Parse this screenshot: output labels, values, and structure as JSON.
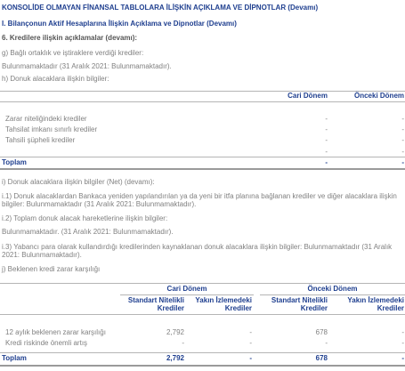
{
  "header": {
    "title": "KONSOLİDE OLMAYAN FİNANSAL TABLOLARA İLİŞKİN AÇIKLAMA VE DİPNOTLAR (Devamı)",
    "section": "I. Bilançonun Aktif Hesaplarına İlişkin Açıklama ve Dipnotlar (Devamı)",
    "subsection": "6. Kredilere ilişkin açıklamalar (devamı):"
  },
  "g": {
    "heading": "g) Bağlı ortaklık ve iştiraklere verdiği krediler:",
    "text": "Bulunmamaktadır (31 Aralık 2021: Bulunmamaktadır)."
  },
  "h": {
    "heading": "h) Donuk alacaklara ilişkin bilgiler:",
    "columns": [
      "Cari Dönem",
      "Önceki Dönem"
    ],
    "rows": [
      {
        "label": "Zarar niteliğindeki krediler",
        "cari": "-",
        "onceki": "-"
      },
      {
        "label": "Tahsilat imkanı sınırlı krediler",
        "cari": "-",
        "onceki": "-"
      },
      {
        "label": "Tahsili şüpheli krediler",
        "cari": "-",
        "onceki": "-"
      },
      {
        "label": "",
        "cari": "-",
        "onceki": "-"
      }
    ],
    "total": {
      "label": "Toplam",
      "cari": "-",
      "onceki": "-"
    }
  },
  "i": {
    "heading": "i) Donuk alacaklara ilişkin bilgiler (Net) (devamı):",
    "i1_line1": "i.1) Donuk alacaklardan Bankaca yeniden yapılandırılan ya da yeni bir itfa planına bağlanan krediler ve diğer alacaklara ilişkin",
    "i1_line2": "bilgiler: Bulunmamaktadır (31 Aralık 2021: Bulunmamaktadır).",
    "i2": "i.2) Toplam donuk alacak hareketlerine ilişkin bilgiler:",
    "i2_text": "Bulunmamaktadır. (31 Aralık 2021: Bulunmamaktadır).",
    "i3_line1": "i.3) Yabancı para olarak kullandırdığı kredilerinden kaynaklanan donuk alacaklara ilişkin bilgiler: Bulunmamaktadır (31 Aralık",
    "i3_line2": "2021: Bulunmamaktadır)."
  },
  "j": {
    "heading": "j) Beklenen kredi zarar karşılığı",
    "groups": [
      "Cari Dönem",
      "Önceki Dönem"
    ],
    "sub1": [
      "Standart Nitelikli",
      "Yakın İzlemedeki",
      "Standart Nitelikli",
      "Yakın İzlemedeki"
    ],
    "sub2": [
      "Krediler",
      "Krediler",
      "Krediler",
      "Krediler"
    ],
    "rows": [
      {
        "label": "12 aylık beklenen zarar karşılığı",
        "v": [
          "2,792",
          "-",
          "678",
          "-"
        ]
      },
      {
        "label": "Kredi riskinde önemli artış",
        "v": [
          "-",
          "-",
          "-",
          "-"
        ]
      }
    ],
    "total": {
      "label": "Toplam",
      "v": [
        "2,792",
        "-",
        "678",
        "-"
      ]
    }
  }
}
